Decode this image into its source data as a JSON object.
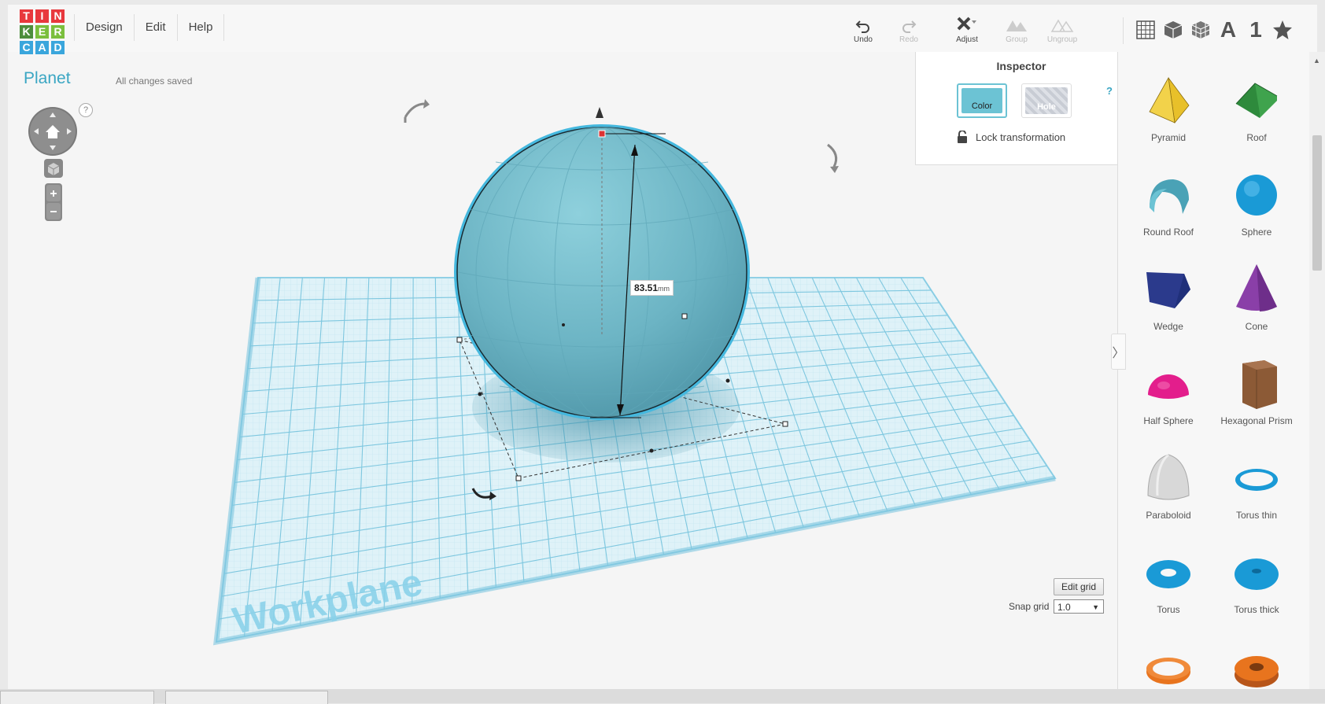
{
  "app": {
    "logo_letters": [
      "T",
      "I",
      "N",
      "K",
      "E",
      "R",
      "C",
      "A",
      "D"
    ],
    "logo_colors": [
      "#e8383d",
      "#e8383d",
      "#e8383d",
      "#4d8d3c",
      "#7bbf3d",
      "#7bbf3d",
      "#3aa6dc",
      "#3aa6dc",
      "#3aa6dc"
    ]
  },
  "menu": [
    "Design",
    "Edit",
    "Help"
  ],
  "toolbar": {
    "undo": "Undo",
    "redo": "Redo",
    "adjust": "Adjust",
    "group": "Group",
    "ungroup": "Ungroup"
  },
  "views": {
    "text_tool": "A",
    "number_tool": "1"
  },
  "project": {
    "title": "Planet",
    "status": "All changes saved"
  },
  "help_mark": "?",
  "dimension": {
    "value": "83.51",
    "unit": "mm"
  },
  "inspector": {
    "title": "Inspector",
    "help": "?",
    "color_label": "Color",
    "hole_label": "Hole",
    "lock_label": "Lock transformation",
    "color_value": "#6cc3d4"
  },
  "workplane": {
    "label": "Workplane"
  },
  "grid": {
    "edit_label": "Edit grid",
    "snap_label": "Snap grid",
    "snap_value": "1.0"
  },
  "shapes": [
    {
      "name": "Pyramid",
      "icon": "pyramid-icon",
      "color": "#e8c02a"
    },
    {
      "name": "Roof",
      "icon": "roof-icon",
      "color": "#3fa34d"
    },
    {
      "name": "Round Roof",
      "icon": "round-roof-icon",
      "color": "#6cc3d4"
    },
    {
      "name": "Sphere",
      "icon": "sphere-icon",
      "color": "#1a9ad6"
    },
    {
      "name": "Wedge",
      "icon": "wedge-icon",
      "color": "#2b3a8c"
    },
    {
      "name": "Cone",
      "icon": "cone-icon",
      "color": "#8a3fa8"
    },
    {
      "name": "Half Sphere",
      "icon": "half-sphere-icon",
      "color": "#e31e8c"
    },
    {
      "name": "Hexagonal Prism",
      "icon": "hexagonal-prism-icon",
      "color": "#8c5a36"
    },
    {
      "name": "Paraboloid",
      "icon": "paraboloid-icon",
      "color": "#d8d8d8"
    },
    {
      "name": "Torus thin",
      "icon": "torus-thin-icon",
      "color": "#1a9ad6"
    },
    {
      "name": "Torus",
      "icon": "torus-icon",
      "color": "#1a9ad6"
    },
    {
      "name": "Torus thick",
      "icon": "torus-thick-icon",
      "color": "#1a9ad6"
    },
    {
      "name": "",
      "icon": "tube-icon",
      "color": "#e8741e"
    },
    {
      "name": "",
      "icon": "ring-icon",
      "color": "#e8741e"
    }
  ]
}
